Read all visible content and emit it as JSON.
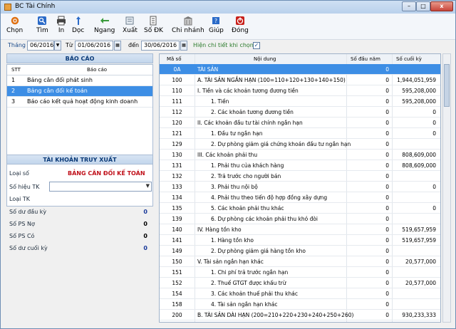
{
  "window": {
    "title": "BC Tài Chính",
    "min": "–",
    "max": "□",
    "close": "x"
  },
  "toolbar": [
    {
      "label": "Chọn",
      "icon": "gear-icon",
      "color": "#e07010"
    },
    {
      "label": "Tìm",
      "icon": "search-icon",
      "color": "#2a6ac8"
    },
    {
      "label": "In",
      "icon": "printer-icon",
      "color": "#444444"
    },
    {
      "label": "Dọc",
      "icon": "portrait-icon",
      "color": "#2a6ac8"
    },
    {
      "label": "Ngang",
      "icon": "landscape-icon",
      "color": "#3a9a3a"
    },
    {
      "label": "Xuất",
      "icon": "export-icon",
      "color": "#6a7a8a"
    },
    {
      "label": "Số ĐK",
      "icon": "ledger-icon",
      "color": "#555555"
    },
    {
      "label": "Chi nhánh",
      "icon": "building-icon",
      "color": "#777777"
    },
    {
      "label": "Giúp",
      "icon": "help-icon",
      "color": "#2a6ac8"
    },
    {
      "label": "Đóng",
      "icon": "power-icon",
      "color": "#c8201a"
    }
  ],
  "filter": {
    "month_label": "Tháng",
    "month_value": "06/2016",
    "from_label": "Từ",
    "from_value": "01/06/2016",
    "to_label": "đến",
    "to_value": "30/06/2016",
    "detail_label": "Hiện chi tiết khi chọn",
    "detail_checked": true
  },
  "reports": {
    "header": "BÁO CÁO",
    "col_stt": "STT",
    "col_name": "Báo cáo",
    "items": [
      {
        "stt": "1",
        "name": "Bảng cân đối phát sinh",
        "selected": false
      },
      {
        "stt": "2",
        "name": "Bảng cân đối kế toán",
        "selected": true
      },
      {
        "stt": "3",
        "name": "Báo cáo kết quả hoạt động kinh doanh",
        "selected": false
      }
    ]
  },
  "account": {
    "header": "TÀI KHOẢN TRUY XUẤT",
    "loai_so_label": "Loại số",
    "loai_so_value": "BẢNG CÂN ĐỐI KẾ TOÁN",
    "so_hieu_label": "Số hiệu TK",
    "loai_tk_label": "Loại TK",
    "du_dau_label": "Số dư đầu kỳ",
    "du_dau_value": "0",
    "ps_no_label": "Số PS Nợ",
    "ps_no_value": "0",
    "ps_co_label": "Số PS Có",
    "ps_co_value": "0",
    "du_cuoi_label": "Số dư cuối kỳ",
    "du_cuoi_value": "0"
  },
  "grid": {
    "columns": [
      "Mã số",
      "Nội dung",
      "Số đầu năm",
      "Số cuối kỳ"
    ],
    "rows": [
      {
        "code": "0A",
        "content": "TÀI SẢN",
        "indent": 0,
        "start": "0",
        "end": "",
        "selected": true
      },
      {
        "code": "100",
        "content": "A. TÀI SẢN NGẮN HẠN (100=110+120+130+140+150)",
        "indent": 0,
        "start": "0",
        "end": "1,944,051,959"
      },
      {
        "code": "110",
        "content": "I. Tiền và các khoản tương đương tiền",
        "indent": 0,
        "start": "0",
        "end": "595,208,000"
      },
      {
        "code": "111",
        "content": "1. Tiền",
        "indent": 1,
        "start": "0",
        "end": "595,208,000"
      },
      {
        "code": "112",
        "content": "2. Các khoản tương đương tiền",
        "indent": 1,
        "start": "0",
        "end": "0"
      },
      {
        "code": "120",
        "content": "II. Các khoản đầu tư tài chính ngắn hạn",
        "indent": 0,
        "start": "0",
        "end": "0"
      },
      {
        "code": "121",
        "content": "1. Đầu tư ngắn hạn",
        "indent": 1,
        "start": "0",
        "end": "0"
      },
      {
        "code": "129",
        "content": "2. Dự phòng giảm giá chứng khoán đầu tư ngắn hạn",
        "indent": 1,
        "start": "0",
        "end": ""
      },
      {
        "code": "130",
        "content": "III. Các khoản phải thu",
        "indent": 0,
        "start": "0",
        "end": "808,609,000"
      },
      {
        "code": "131",
        "content": "1. Phải thu của khách hàng",
        "indent": 1,
        "start": "0",
        "end": "808,609,000"
      },
      {
        "code": "132",
        "content": "2. Trả trước cho người bán",
        "indent": 1,
        "start": "0",
        "end": ""
      },
      {
        "code": "133",
        "content": "3. Phải thu nội bộ",
        "indent": 1,
        "start": "0",
        "end": "0"
      },
      {
        "code": "134",
        "content": "4. Phải thu theo tiến độ hợp đồng xây dựng",
        "indent": 1,
        "start": "0",
        "end": ""
      },
      {
        "code": "135",
        "content": "5. Các khoản phải thu khác",
        "indent": 1,
        "start": "0",
        "end": "0"
      },
      {
        "code": "139",
        "content": "6. Dự phòng các khoản phải thu khó đòi",
        "indent": 1,
        "start": "0",
        "end": ""
      },
      {
        "code": "140",
        "content": "IV. Hàng tồn kho",
        "indent": 0,
        "start": "0",
        "end": "519,657,959"
      },
      {
        "code": "141",
        "content": "1. Hàng tồn kho",
        "indent": 1,
        "start": "0",
        "end": "519,657,959"
      },
      {
        "code": "149",
        "content": "2. Dự phòng giảm giá hàng tồn kho",
        "indent": 1,
        "start": "0",
        "end": ""
      },
      {
        "code": "150",
        "content": "V. Tài sản ngắn hạn khác",
        "indent": 0,
        "start": "0",
        "end": "20,577,000"
      },
      {
        "code": "151",
        "content": "1. Chi phí trả trước ngắn hạn",
        "indent": 1,
        "start": "0",
        "end": ""
      },
      {
        "code": "152",
        "content": "2. Thuế GTGT được khấu trừ",
        "indent": 1,
        "start": "0",
        "end": "20,577,000"
      },
      {
        "code": "154",
        "content": "3. Các khoản thuế phải thu khác",
        "indent": 1,
        "start": "0",
        "end": ""
      },
      {
        "code": "158",
        "content": "4. Tài sản ngắn hạn khác",
        "indent": 1,
        "start": "0",
        "end": ""
      },
      {
        "code": "200",
        "content": "B. TÀI SẢN DÀI HẠN (200=210+220+230+240+250+260)",
        "indent": 0,
        "start": "0",
        "end": "930,233,333"
      },
      {
        "code": "210",
        "content": "I. Các khoản phải thu dài hạn",
        "indent": 0,
        "start": "0",
        "end": ""
      }
    ]
  }
}
